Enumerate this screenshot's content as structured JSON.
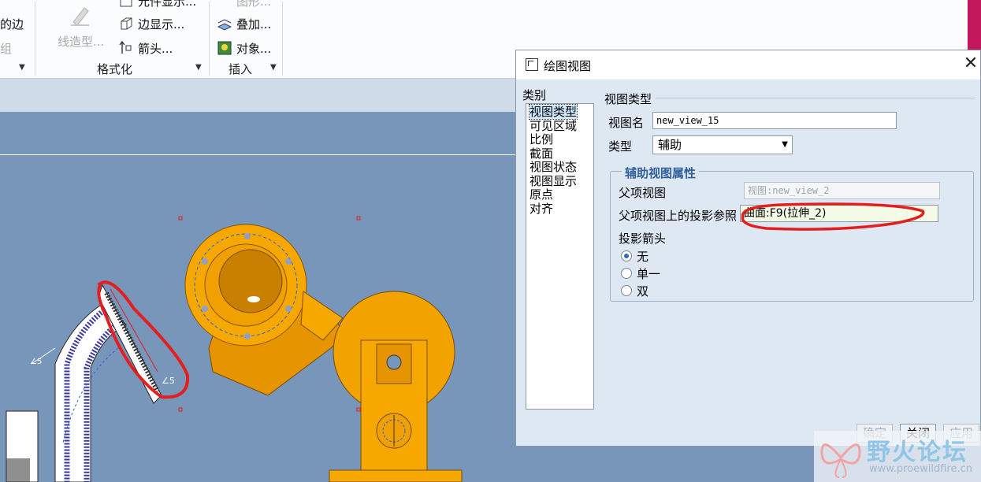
{
  "ribbon": {
    "frag_edge": "的边",
    "frag_group": "组",
    "line_style": "线造型...",
    "element_display": "元件显示...",
    "edge_display": "边显示...",
    "arrow": "箭头...",
    "shape_frag": "图形...",
    "overlay": "叠加...",
    "object": "对象...",
    "group_format": "格式化",
    "group_insert": "插入"
  },
  "dialog": {
    "title": "绘图视图",
    "category_label": "类别",
    "categories": [
      "视图类型",
      "可见区域",
      "比例",
      "截面",
      "视图状态",
      "视图显示",
      "原点",
      "对齐"
    ],
    "view_type_header": "视图类型",
    "view_name_label": "视图名",
    "view_name_value": "new_view_15",
    "type_label": "类型",
    "type_value": "辅助",
    "aux_props_title": "辅助视图属性",
    "parent_view_label": "父项视图",
    "parent_view_value": "视图:new_view_2",
    "proj_ref_label": "父项视图上的投影参照",
    "proj_ref_value": "曲面:F9(拉伸_2)",
    "proj_arrow_label": "投影箭头",
    "radio_options": [
      "无",
      "单一",
      "双"
    ],
    "buttons": {
      "ok": "确定",
      "close": "关闭",
      "apply": "应用"
    }
  },
  "watermark": {
    "text": "野火论坛",
    "url": "www.proewildfire.cn"
  },
  "colors": {
    "canvas": "#7896ba",
    "part": "#f7a800",
    "annotation_red": "#e41e1e",
    "accent": "#2e5f9a"
  }
}
